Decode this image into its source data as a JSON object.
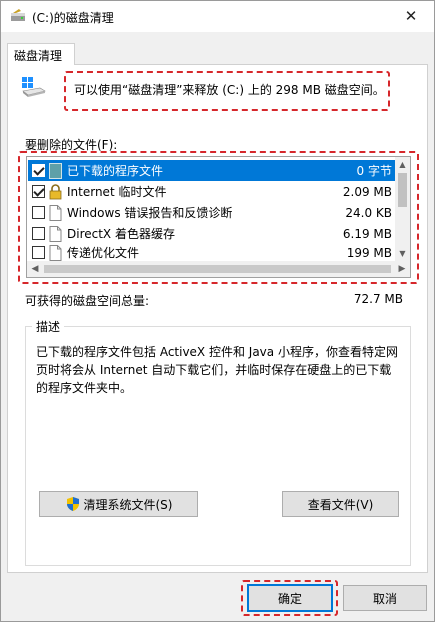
{
  "window": {
    "title": "(C:)的磁盘清理",
    "close_glyph": "✕"
  },
  "tab": {
    "label": "磁盘清理"
  },
  "info": {
    "text": "可以使用“磁盘清理”来释放  (C:) 上的 298 MB 磁盘空间。"
  },
  "files_section": {
    "label": "要删除的文件(F):",
    "items": [
      {
        "name": "已下载的程序文件",
        "size": "0 字节",
        "checked": true,
        "selected": true,
        "icon": "program-folder-icon"
      },
      {
        "name": "Internet 临时文件",
        "size": "2.09 MB",
        "checked": true,
        "selected": false,
        "icon": "lock-icon"
      },
      {
        "name": "Windows 错误报告和反馈诊断",
        "size": "24.0 KB",
        "checked": false,
        "selected": false,
        "icon": "file-icon"
      },
      {
        "name": "DirectX 着色器缓存",
        "size": "6.19 MB",
        "checked": false,
        "selected": false,
        "icon": "file-icon"
      },
      {
        "name": "传递优化文件",
        "size": "199 MB",
        "checked": false,
        "selected": false,
        "icon": "file-icon"
      }
    ]
  },
  "space": {
    "label": "可获得的磁盘空间总量:",
    "value": "72.7 MB"
  },
  "description": {
    "legend": "描述",
    "line1": "已下载的程序文件包括 ActiveX 控件和 Java 小程序，你查看特定网",
    "line2": "页时将会从 Internet 自动下载它们，并临时保存在硬盘上的已下载",
    "line3": "的程序文件夹中。"
  },
  "buttons": {
    "cleanup_system": "清理系统文件(S)",
    "view_files": "查看文件(V)",
    "ok": "确定",
    "cancel": "取消"
  },
  "colors": {
    "highlight": "#d6272b",
    "selection": "#0078d7"
  }
}
